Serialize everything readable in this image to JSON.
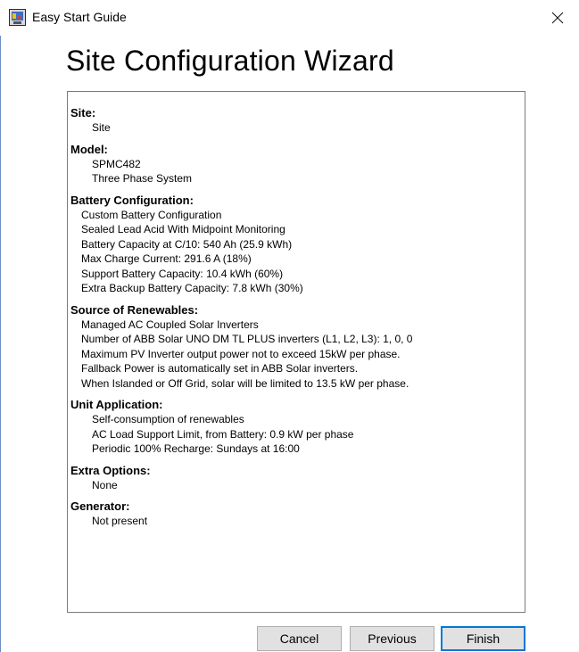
{
  "window": {
    "title": "Easy Start Guide",
    "close_symbol": "×"
  },
  "wizard_title": "Site Configuration Wizard",
  "sections": {
    "site": {
      "title": "Site:",
      "lines": [
        "Site"
      ]
    },
    "model": {
      "title": "Model:",
      "lines": [
        "SPMC482",
        "Three Phase System"
      ]
    },
    "battery": {
      "title": "Battery Configuration:",
      "lines": [
        "Custom Battery Configuration",
        "Sealed Lead Acid With Midpoint Monitoring",
        "Battery Capacity at C/10: 540 Ah (25.9 kWh)",
        "Max Charge Current: 291.6 A (18%)",
        "Support Battery Capacity: 10.4 kWh (60%)",
        "Extra Backup Battery Capacity: 7.8 kWh (30%)"
      ]
    },
    "renewables": {
      "title": "Source of Renewables:",
      "lines": [
        "Managed AC Coupled Solar Inverters",
        "Number of ABB Solar UNO DM TL PLUS inverters (L1, L2, L3): 1, 0, 0",
        "Maximum PV Inverter output power not to exceed 15kW per phase.",
        "Fallback Power is automatically set in ABB Solar inverters.",
        "When Islanded or Off Grid, solar will be limited to 13.5 kW per phase."
      ]
    },
    "application": {
      "title": "Unit Application:",
      "lines": [
        "Self-consumption of renewables",
        "AC Load Support Limit, from Battery: 0.9 kW per phase",
        "Periodic 100% Recharge: Sundays at 16:00"
      ]
    },
    "extra": {
      "title": "Extra Options:",
      "lines": [
        "None"
      ]
    },
    "generator": {
      "title": "Generator:",
      "lines": [
        "Not present"
      ]
    }
  },
  "buttons": {
    "cancel": "Cancel",
    "previous": "Previous",
    "finish": "Finish"
  },
  "colors": {
    "button_face": "#e1e1e1",
    "default_button_border": "#0078d7",
    "box_border": "#7a7a7a"
  }
}
